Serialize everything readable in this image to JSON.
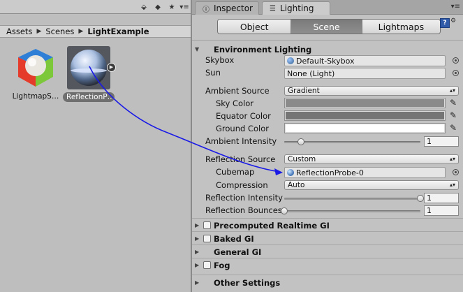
{
  "project": {
    "breadcrumb": [
      "Assets",
      "Scenes",
      "LightExample"
    ],
    "assets": [
      {
        "name": "LightmapS…",
        "icon": "lighting-settings-icon"
      },
      {
        "name": "ReflectionP…",
        "icon": "reflection-probe-icon"
      }
    ]
  },
  "tabs": {
    "inspector": "Inspector",
    "lighting": "Lighting"
  },
  "mode_buttons": {
    "object": "Object",
    "scene": "Scene",
    "lightmaps": "Lightmaps",
    "active": "scene"
  },
  "environment": {
    "title": "Environment Lighting",
    "skybox_label": "Skybox",
    "skybox_value": "Default-Skybox",
    "sun_label": "Sun",
    "sun_value": "None (Light)",
    "ambient_source_label": "Ambient Source",
    "ambient_source_value": "Gradient",
    "sky_color_label": "Sky Color",
    "equator_color_label": "Equator Color",
    "ground_color_label": "Ground Color",
    "ambient_intensity_label": "Ambient Intensity",
    "ambient_intensity_value": "1",
    "ambient_intensity_slider": 0.125,
    "reflection_source_label": "Reflection Source",
    "reflection_source_value": "Custom",
    "cubemap_label": "Cubemap",
    "cubemap_value": "ReflectionProbe-0",
    "compression_label": "Compression",
    "compression_value": "Auto",
    "reflection_intensity_label": "Reflection Intensity",
    "reflection_intensity_value": "1",
    "reflection_intensity_slider": 1.0,
    "reflection_bounces_label": "Reflection Bounces",
    "reflection_bounces_value": "1",
    "reflection_bounces_slider": 0.0
  },
  "sections": {
    "precomputed": "Precomputed Realtime GI",
    "baked": "Baked GI",
    "general": "General GI",
    "fog": "Fog",
    "other": "Other Settings"
  },
  "colors": {
    "sky_color": "#8a8a8a",
    "equator_color": "#757575",
    "ground_color": "#ffffff",
    "annotation_arrow": "#1a1ae6",
    "active_mode": "#7f7f7f"
  }
}
